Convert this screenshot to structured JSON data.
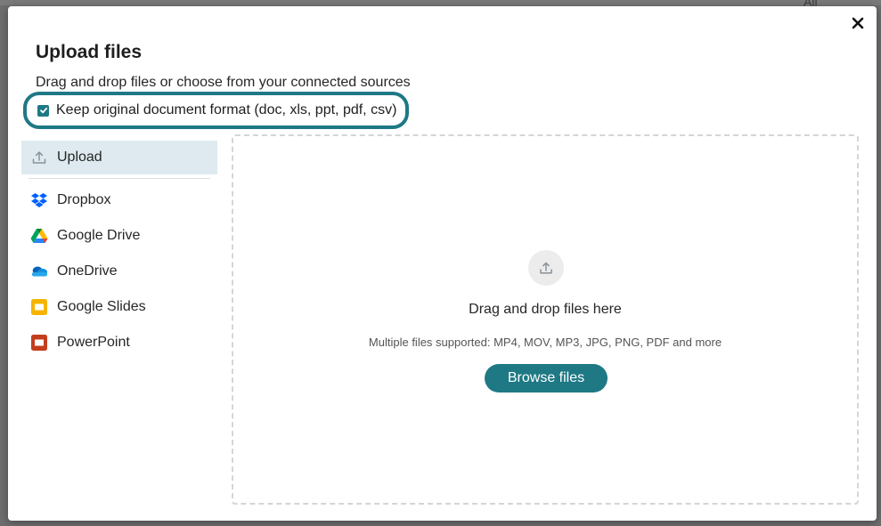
{
  "background": {
    "peek_text": "All"
  },
  "modal": {
    "title": "Upload files",
    "subtitle": "Drag and drop files or choose from your connected sources",
    "keep_format": {
      "label": "Keep original document format (doc, xls, ppt, pdf, csv)",
      "checked": true
    },
    "close_icon": "close-icon"
  },
  "sidebar": {
    "items": [
      {
        "label": "Upload",
        "icon": "upload-icon",
        "active": true
      },
      {
        "label": "Dropbox",
        "icon": "dropbox-icon"
      },
      {
        "label": "Google Drive",
        "icon": "google-drive-icon"
      },
      {
        "label": "OneDrive",
        "icon": "onedrive-icon"
      },
      {
        "label": "Google Slides",
        "icon": "google-slides-icon"
      },
      {
        "label": "PowerPoint",
        "icon": "powerpoint-icon"
      }
    ]
  },
  "dropzone": {
    "title": "Drag and drop files here",
    "hint": "Multiple files supported: MP4, MOV, MP3, JPG, PNG, PDF and more",
    "button": "Browse files"
  },
  "colors": {
    "accent": "#1e7985",
    "active_bg": "#deeaef",
    "backdrop": "#6e6e6e"
  }
}
